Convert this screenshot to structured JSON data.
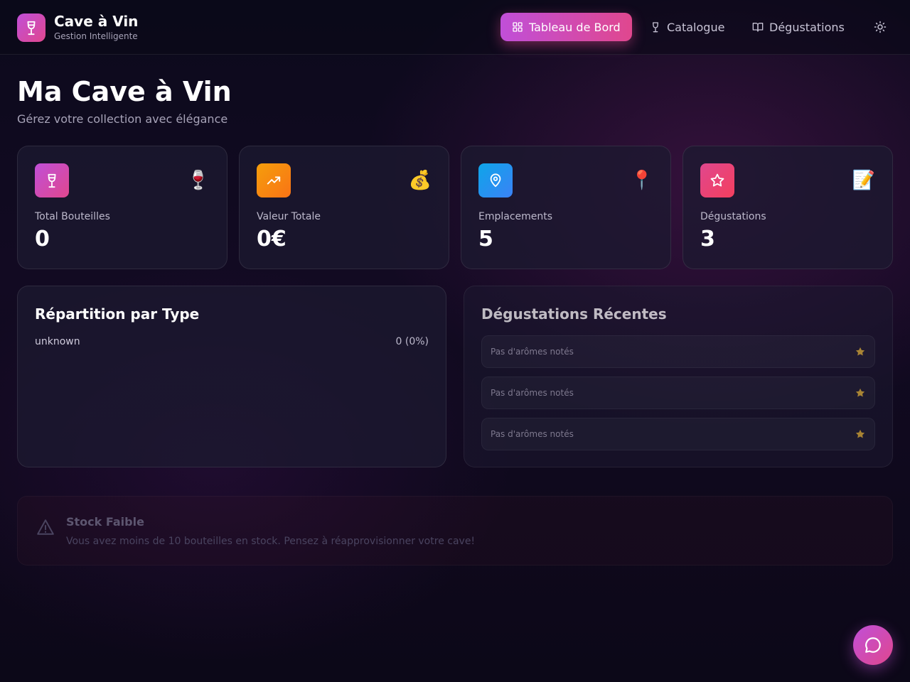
{
  "app": {
    "title": "Cave à Vin",
    "subtitle": "Gestion Intelligente"
  },
  "nav": {
    "items": [
      {
        "label": "Tableau de Bord",
        "icon": "grid-icon",
        "active": true
      },
      {
        "label": "Catalogue",
        "icon": "wine-glass-icon",
        "active": false
      },
      {
        "label": "Dégustations",
        "icon": "book-open-icon",
        "active": false
      }
    ],
    "theme_icon": "sun-icon"
  },
  "page": {
    "title": "Ma Cave à Vin",
    "subtitle": "Gérez votre collection avec élégance"
  },
  "stats": [
    {
      "label": "Total Bouteilles",
      "value": "0",
      "emoji": "🍷",
      "icon": "wine-glass-icon",
      "color_from": "#c04fd8",
      "color_to": "#e0478e"
    },
    {
      "label": "Valeur Totale",
      "value": "0€",
      "emoji": "💰",
      "icon": "trending-up-icon",
      "color_from": "#f59e0b",
      "color_to": "#f97316"
    },
    {
      "label": "Emplacements",
      "value": "5",
      "emoji": "📍",
      "icon": "map-pin-icon",
      "color_from": "#0ea5e9",
      "color_to": "#3b82f6"
    },
    {
      "label": "Dégustations",
      "value": "3",
      "emoji": "📝",
      "icon": "star-icon",
      "color_from": "#e0478e",
      "color_to": "#f43f5e"
    }
  ],
  "distribution": {
    "title": "Répartition par Type",
    "rows": [
      {
        "label": "unknown",
        "value": "0 (0%)"
      }
    ]
  },
  "recent_tastings": {
    "title": "Dégustations Récentes",
    "items": [
      {
        "text": "Pas d'arômes notés",
        "icon": "star-icon"
      },
      {
        "text": "Pas d'arômes notés",
        "icon": "star-icon"
      },
      {
        "text": "Pas d'arômes notés",
        "icon": "star-icon"
      }
    ]
  },
  "alert": {
    "title": "Stock Faible",
    "text": "Vous avez moins de 10 bouteilles en stock. Pensez à réapprovisionner votre cave!",
    "icon": "warning-icon"
  },
  "chat": {
    "icon": "chat-bubble-icon"
  },
  "colors": {
    "accent_from": "#c04fd8",
    "accent_to": "#e0478e",
    "star": "#e2b33c"
  }
}
